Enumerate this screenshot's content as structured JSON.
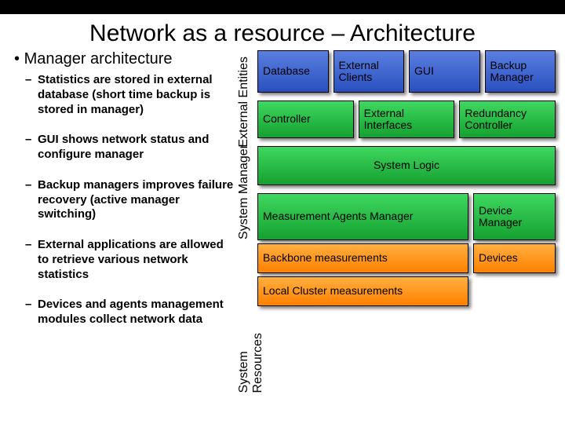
{
  "title": "Network as a resource – Architecture",
  "heading": "Manager architecture",
  "subs": [
    "Statistics are stored in external database (short time backup is stored in manager)",
    "GUI shows network status and configure manager",
    "Backup managers improves failure recovery (active manager switching)",
    "External applications are allowed to retrieve various network statistics",
    "Devices and agents management modules collect network data"
  ],
  "vlabels": {
    "ext": "External Entities",
    "sys": "System Manager",
    "res": "System Resources"
  },
  "row1": [
    "Database",
    "External Clients",
    "GUI",
    "Backup Manager"
  ],
  "row2": [
    "Controller",
    "External Interfaces",
    "Redundancy Controller"
  ],
  "syslogic": "System Logic",
  "row3b": [
    "Measurement Agents Manager",
    "Device Manager"
  ],
  "row4": [
    "Backbone measurements",
    "Devices"
  ],
  "row5": "Local Cluster measurements"
}
